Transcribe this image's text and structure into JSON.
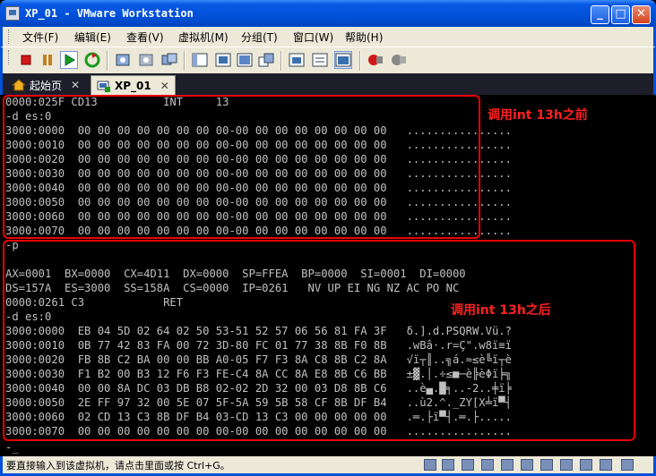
{
  "window": {
    "title": "XP_01 - VMware Workstation",
    "minimize": "_",
    "maximize": "□",
    "close": "✕"
  },
  "menu": [
    "文件(F)",
    "编辑(E)",
    "查看(V)",
    "虚拟机(M)",
    "分组(T)",
    "窗口(W)",
    "帮助(H)"
  ],
  "tabs": [
    {
      "label": "起始页",
      "close": "✕"
    },
    {
      "label": "XP_01",
      "close": "✕"
    }
  ],
  "console": {
    "lines": [
      "0000:025F CD13          INT     13",
      "-d es:0",
      "3000:0000  00 00 00 00 00 00 00 00-00 00 00 00 00 00 00 00   ................",
      "3000:0010  00 00 00 00 00 00 00 00-00 00 00 00 00 00 00 00   ................",
      "3000:0020  00 00 00 00 00 00 00 00-00 00 00 00 00 00 00 00   ................",
      "3000:0030  00 00 00 00 00 00 00 00-00 00 00 00 00 00 00 00   ................",
      "3000:0040  00 00 00 00 00 00 00 00-00 00 00 00 00 00 00 00   ................",
      "3000:0050  00 00 00 00 00 00 00 00-00 00 00 00 00 00 00 00   ................",
      "3000:0060  00 00 00 00 00 00 00 00-00 00 00 00 00 00 00 00   ................",
      "3000:0070  00 00 00 00 00 00 00 00-00 00 00 00 00 00 00 00   ................",
      "-p",
      "",
      "AX=0001  BX=0000  CX=4D11  DX=0000  SP=FFEA  BP=0000  SI=0001  DI=0000",
      "DS=157A  ES=3000  SS=158A  CS=0000  IP=0261   NV UP EI NG NZ AC PO NC",
      "0000:0261 C3            RET",
      "-d es:0",
      "3000:0000  EB 04 5D 02 64 02 50 53-51 52 57 06 56 81 FA 3F   δ.].d.PSQRW.Vü.?",
      "3000:0010  0B 77 42 83 FA 00 72 3D-80 FC 01 77 38 8B F0 8B   .wBâ·.r=Ç\".w8ï≡ï",
      "3000:0020  FB 8B C2 BA 00 00 BB A0-05 F7 F3 8A C8 8B C2 8A   √ï┬║..╗á.≈≤è╚ï┬è",
      "3000:0030  F1 B2 00 B3 12 F6 F3 FE-C4 8A CC 8A E8 8B C6 BB   ±▓.│.÷≤■─è╠èΦï╞╗",
      "3000:0040  00 00 8A DC 03 DB B8 02-02 2D 32 00 03 D8 8B C6   ..è▄.█╕..-2..╪ï╞",
      "3000:0050  2E FF 97 32 00 5E 07 5F-5A 59 5B 58 CF 8B DF B4   ..ù2.^._ZY[X╧ï▀┤",
      "3000:0060  02 CD 13 C3 8B DF B4 03-CD 13 C3 00 00 00 00 00   .═.├ï▀┤.═.├.....",
      "3000:0070  00 00 00 00 00 00 00 00-00 00 00 00 00 00 00 00   ................",
      "-_"
    ],
    "annotation_before": "调用int 13h之前",
    "annotation_after": "调用int 13h之后"
  },
  "status": {
    "text": "要直接输入到该虚拟机，请点击里面或按 Ctrl+G。"
  },
  "colors": {
    "accent": "#0050d8",
    "annotation": "#ff2020"
  }
}
